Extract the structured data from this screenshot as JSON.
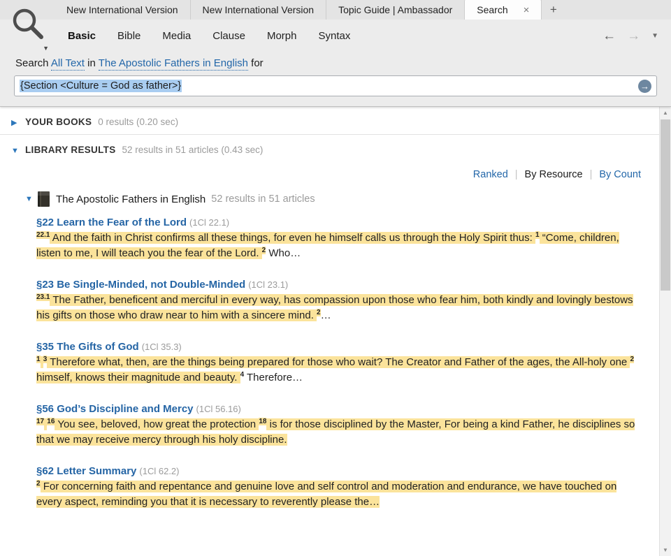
{
  "colors": {
    "accent_blue": "#2367a9",
    "highlight_yellow": "#fbe39b",
    "selection_blue": "#a9cdf1"
  },
  "icons": {
    "close": "×",
    "add": "+",
    "back": "←",
    "forward": "→",
    "dropdown": "▼",
    "collapsed": "▶",
    "expanded": "▼",
    "go": "→",
    "scroll_up": "▲",
    "scroll_down": "▼",
    "panel": "search-icon",
    "resource": "book-cover-icon"
  },
  "tabs": {
    "items": [
      {
        "label": "New International Version",
        "active": false,
        "closable": false
      },
      {
        "label": "New International Version",
        "active": false,
        "closable": false
      },
      {
        "label": "Topic Guide | Ambassador",
        "active": false,
        "closable": false
      },
      {
        "label": "Search",
        "active": true,
        "closable": true
      }
    ]
  },
  "nav": {
    "items": [
      {
        "label": "Basic",
        "active": true
      },
      {
        "label": "Bible",
        "active": false
      },
      {
        "label": "Media",
        "active": false
      },
      {
        "label": "Clause",
        "active": false
      },
      {
        "label": "Morph",
        "active": false
      },
      {
        "label": "Syntax",
        "active": false
      }
    ]
  },
  "scope": {
    "word_search": "Search",
    "field": "All Text",
    "word_in": "in",
    "resource": "The Apostolic Fathers in English",
    "word_for": "for"
  },
  "query": {
    "text": "{Section <Culture = God as father>}"
  },
  "sections": {
    "your_books": {
      "title": "YOUR BOOKS",
      "summary": "0 results (0.20 sec)"
    },
    "library": {
      "title": "LIBRARY RESULTS",
      "summary": "52 results in 51 articles (0.43 sec)"
    }
  },
  "sort": {
    "options": [
      {
        "label": "Ranked",
        "active": false
      },
      {
        "label": "By Resource",
        "active": true
      },
      {
        "label": "By Count",
        "active": false
      }
    ]
  },
  "resource": {
    "title": "The Apostolic Fathers in English",
    "summary": "52 results in 51 articles"
  },
  "results": [
    {
      "title": "§22 Learn the Fear of the Lord",
      "ref": "(1Cl 22.1)",
      "segments": [
        {
          "text": "22.1",
          "sup": true,
          "hl": true
        },
        {
          "text": " And the faith in Christ confirms all these things, for even he himself calls us through the Holy Spirit thus: ",
          "sup": false,
          "hl": true
        },
        {
          "text": "1",
          "sup": true,
          "hl": true
        },
        {
          "text": " “Come, children, listen to me, I will teach you the fear of the Lord. ",
          "sup": false,
          "hl": true
        },
        {
          "text": "2",
          "sup": true,
          "hl": true
        },
        {
          "text": " Who…",
          "sup": false,
          "hl": false
        }
      ]
    },
    {
      "title": "§23 Be Single-Minded, not Double-Minded",
      "ref": "(1Cl 23.1)",
      "segments": [
        {
          "text": "23.1",
          "sup": true,
          "hl": true
        },
        {
          "text": " The Father, beneficent and merciful in every way, has compassion upon those who fear him, both kindly and lovingly bestows his gifts on those who draw near to him with a sincere mind. ",
          "sup": false,
          "hl": true
        },
        {
          "text": "2",
          "sup": true,
          "hl": true
        },
        {
          "text": "…",
          "sup": false,
          "hl": false
        }
      ]
    },
    {
      "title": "§35 The Gifts of God",
      "ref": "(1Cl 35.3)",
      "segments": [
        {
          "text": "1",
          "sup": true,
          "hl": true
        },
        {
          "text": " ",
          "sup": false,
          "hl": true
        },
        {
          "text": "3",
          "sup": true,
          "hl": true
        },
        {
          "text": " Therefore what, then, are the things being prepared for those who wait? The Creator and Father of the ages, the All-holy one ",
          "sup": false,
          "hl": true
        },
        {
          "text": "2",
          "sup": true,
          "hl": true
        },
        {
          "text": " himself, knows their magnitude and beauty. ",
          "sup": false,
          "hl": true
        },
        {
          "text": "4",
          "sup": true,
          "hl": false
        },
        {
          "text": " Therefore…",
          "sup": false,
          "hl": false
        }
      ]
    },
    {
      "title": "§56 God’s Discipline and Mercy",
      "ref": "(1Cl 56.16)",
      "segments": [
        {
          "text": "17",
          "sup": true,
          "hl": true
        },
        {
          "text": " ",
          "sup": false,
          "hl": true
        },
        {
          "text": "16",
          "sup": true,
          "hl": true
        },
        {
          "text": " You see, beloved, how great the protection ",
          "sup": false,
          "hl": true
        },
        {
          "text": "18",
          "sup": true,
          "hl": true
        },
        {
          "text": " is for those disciplined by the Master, For being a kind Father, he disciplines so that we may receive mercy through his holy discipline.",
          "sup": false,
          "hl": true
        }
      ]
    },
    {
      "title": "§62 Letter Summary",
      "ref": "(1Cl 62.2)",
      "segments": [
        {
          "text": "2",
          "sup": true,
          "hl": true
        },
        {
          "text": " For concerning faith and repentance and genuine love and self control and moderation and endurance, we have touched on every aspect, reminding you that it is necessary to reverently please the…",
          "sup": false,
          "hl": true
        }
      ]
    }
  ]
}
